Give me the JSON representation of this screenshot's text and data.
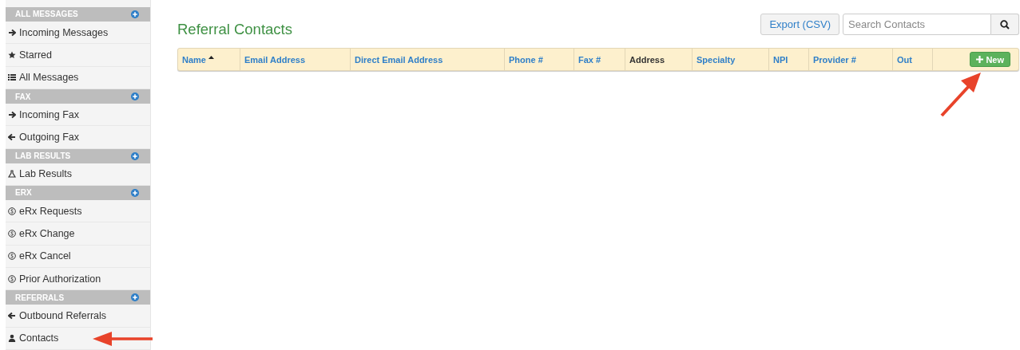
{
  "sidebar": {
    "sections": [
      {
        "title": "ALL MESSAGES",
        "items": [
          {
            "label": "Incoming Messages",
            "kind": "incoming"
          },
          {
            "label": "Starred",
            "kind": "starred"
          },
          {
            "label": "All Messages",
            "kind": "list"
          }
        ]
      },
      {
        "title": "FAX",
        "items": [
          {
            "label": "Incoming Fax",
            "kind": "incoming"
          },
          {
            "label": "Outgoing Fax",
            "kind": "outgoing"
          }
        ]
      },
      {
        "title": "LAB RESULTS",
        "items": [
          {
            "label": "Lab Results",
            "kind": "lab"
          }
        ]
      },
      {
        "title": "ERX",
        "items": [
          {
            "label": "eRx Requests",
            "kind": "erx"
          },
          {
            "label": "eRx Change",
            "kind": "erx"
          },
          {
            "label": "eRx Cancel",
            "kind": "erx"
          },
          {
            "label": "Prior Authorization",
            "kind": "erx"
          }
        ]
      },
      {
        "title": "REFERRALS",
        "items": [
          {
            "label": "Outbound Referrals",
            "kind": "outgoing"
          },
          {
            "label": "Contacts",
            "kind": "contact"
          }
        ]
      }
    ]
  },
  "page": {
    "title": "Referral Contacts",
    "export_button": "Export (CSV)",
    "search": {
      "placeholder": "Search Contacts"
    },
    "table": {
      "columns": [
        {
          "label": "Name",
          "sortable": true,
          "sorted": true
        },
        {
          "label": "Email Address",
          "sortable": true,
          "sorted": false
        },
        {
          "label": "Direct Email Address",
          "sortable": true,
          "sorted": false
        },
        {
          "label": "Phone #",
          "sortable": true,
          "sorted": false
        },
        {
          "label": "Fax #",
          "sortable": true,
          "sorted": false
        },
        {
          "label": "Address",
          "sortable": false,
          "sorted": false
        },
        {
          "label": "Specialty",
          "sortable": true,
          "sorted": false
        },
        {
          "label": "NPI",
          "sortable": true,
          "sorted": false
        },
        {
          "label": "Provider #",
          "sortable": true,
          "sorted": false
        },
        {
          "label": "Out",
          "sortable": true,
          "sorted": false
        }
      ],
      "new_button": "New"
    }
  },
  "annotations": [
    {
      "kind": "arrow"
    },
    {
      "kind": "arrow"
    }
  ]
}
